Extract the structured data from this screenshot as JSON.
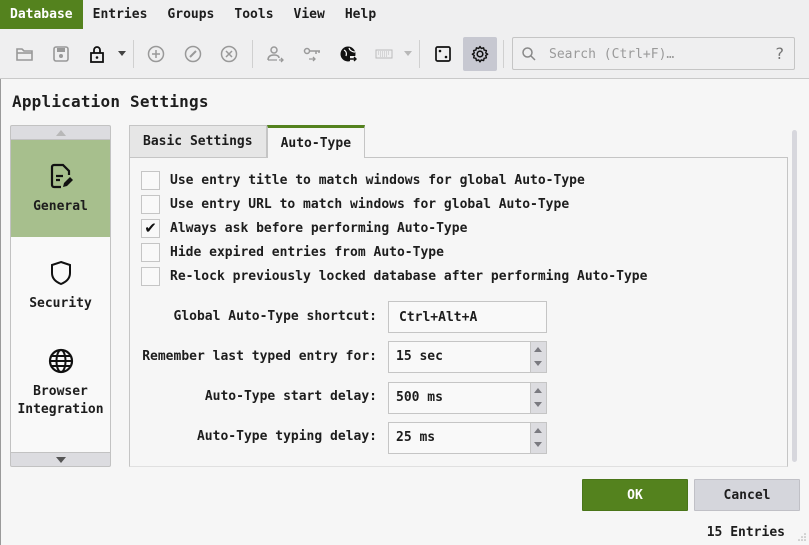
{
  "menubar": {
    "items": [
      {
        "label": "Database",
        "active": true
      },
      {
        "label": "Entries",
        "active": false
      },
      {
        "label": "Groups",
        "active": false
      },
      {
        "label": "Tools",
        "active": false
      },
      {
        "label": "View",
        "active": false
      },
      {
        "label": "Help",
        "active": false
      }
    ]
  },
  "toolbar": {
    "buttons": [
      {
        "icon": "folder-open-icon",
        "tooltip": "Open database"
      },
      {
        "icon": "save-icon",
        "tooltip": "Save database"
      },
      {
        "icon": "lock-icon",
        "tooltip": "Lock database"
      },
      {
        "icon": "add-entry-icon",
        "tooltip": "Add entry"
      },
      {
        "icon": "edit-entry-icon",
        "tooltip": "Edit entry"
      },
      {
        "icon": "delete-entry-icon",
        "tooltip": "Delete entry"
      },
      {
        "icon": "copy-username-icon",
        "tooltip": "Copy username"
      },
      {
        "icon": "copy-password-icon",
        "tooltip": "Copy password"
      },
      {
        "icon": "copy-url-icon",
        "tooltip": "Copy URL"
      },
      {
        "icon": "keyboard-icon",
        "tooltip": "Perform Auto-Type"
      },
      {
        "icon": "dice-icon",
        "tooltip": "Password generator"
      },
      {
        "icon": "gear-icon",
        "tooltip": "Settings",
        "checked": true
      }
    ],
    "search": {
      "placeholder": "Search (Ctrl+F)…",
      "value": "",
      "help": "?"
    }
  },
  "page": {
    "title": "Application Settings"
  },
  "categories": {
    "items": [
      {
        "label": "General",
        "icon": "document-edit-icon",
        "selected": true
      },
      {
        "label": "Security",
        "icon": "shield-icon",
        "selected": false
      },
      {
        "label": "Browser Integration",
        "icon": "globe-icon",
        "selected": false
      }
    ]
  },
  "tabs": [
    {
      "label": "Basic Settings",
      "active": false
    },
    {
      "label": "Auto-Type",
      "active": true
    }
  ],
  "autotype": {
    "checkboxes": [
      {
        "label": "Use entry title to match windows for global Auto-Type",
        "checked": false
      },
      {
        "label": "Use entry URL to match windows for global Auto-Type",
        "checked": false
      },
      {
        "label": "Always ask before performing Auto-Type",
        "checked": true
      },
      {
        "label": "Hide expired entries from Auto-Type",
        "checked": false
      },
      {
        "label": "Re-lock previously locked database after performing Auto-Type",
        "checked": false
      }
    ],
    "shortcut": {
      "label": "Global Auto-Type shortcut:",
      "value": "Ctrl+Alt+A"
    },
    "remember": {
      "label": "Remember last typed entry for:",
      "value": "15 sec"
    },
    "start_delay": {
      "label": "Auto-Type start delay:",
      "value": "500 ms"
    },
    "typing_delay": {
      "label": "Auto-Type typing delay:",
      "value": "25 ms"
    }
  },
  "dialog": {
    "ok_label": "OK",
    "cancel_label": "Cancel"
  },
  "statusbar": {
    "entries": "15 Entries"
  },
  "colors": {
    "accent": "#54821e",
    "selected_category": "#a7bf8d"
  }
}
